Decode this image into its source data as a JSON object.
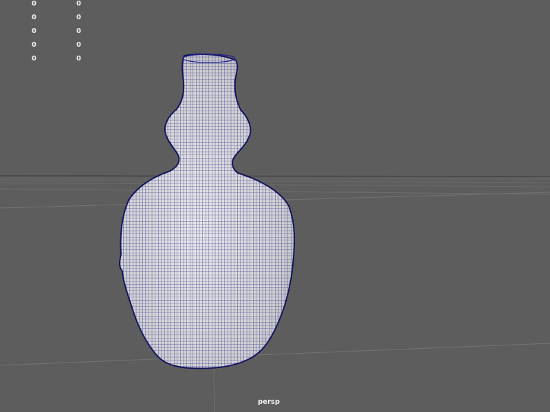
{
  "viewport": {
    "camera_label": "persp",
    "background_color": "#5d5d5d",
    "grid_color": "#6e6e6e",
    "horizon_color": "#484848",
    "mesh_wire_color": "#1f1f8f",
    "mesh_fill_color": "#dcdcdc"
  },
  "hud": {
    "rows": [
      {
        "a": "0",
        "b": "0"
      },
      {
        "a": "0",
        "b": "0"
      },
      {
        "a": "0",
        "b": "0"
      },
      {
        "a": "0",
        "b": "0"
      },
      {
        "a": "0",
        "b": "0"
      }
    ]
  },
  "scene": {
    "object_icon": "gourd-vase-mesh-icon"
  }
}
